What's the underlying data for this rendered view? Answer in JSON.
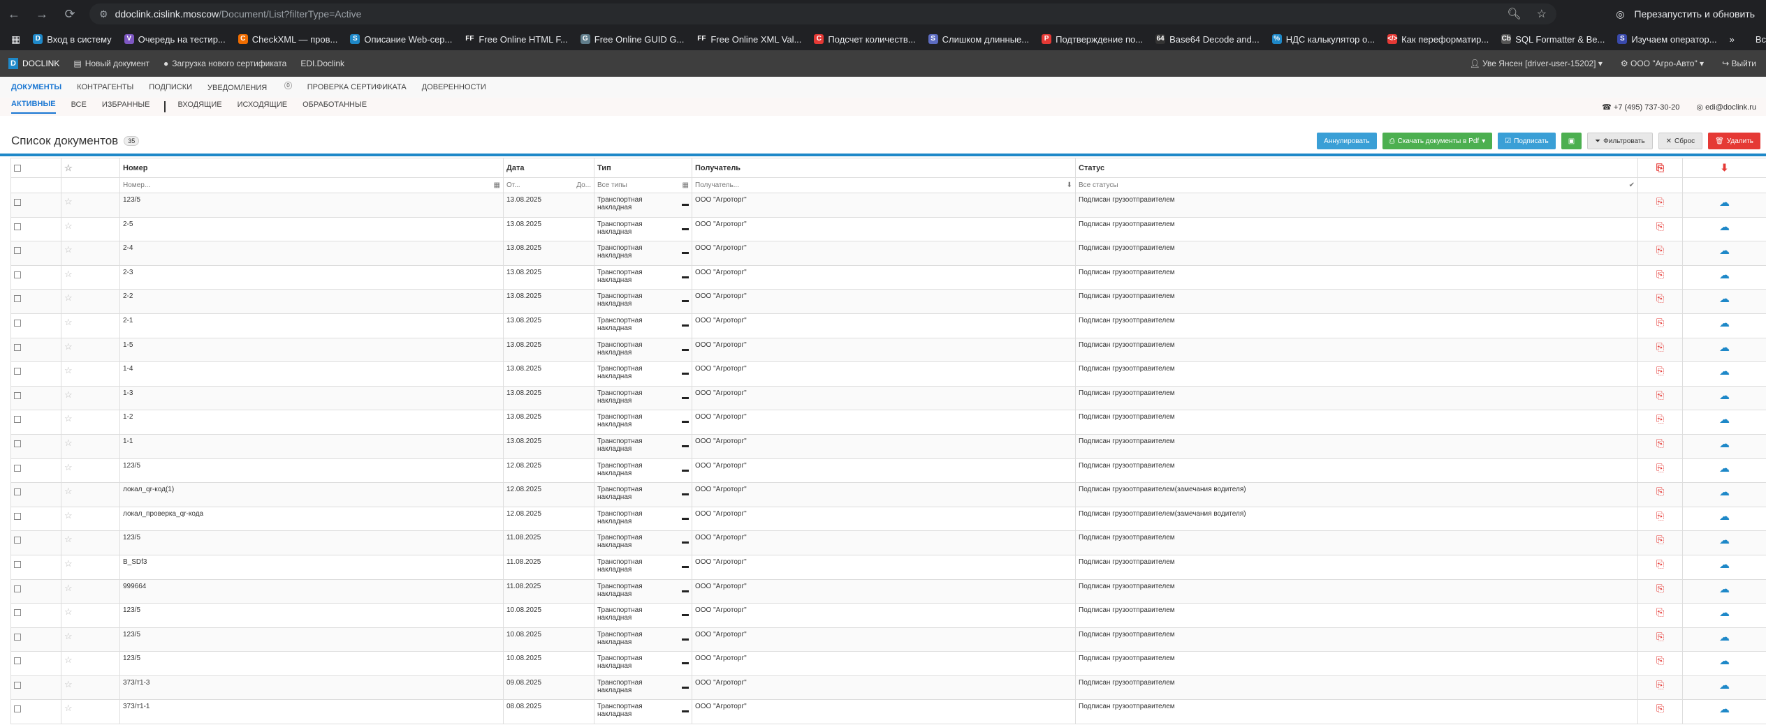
{
  "browser": {
    "url_host": "ddoclink.cislink.moscow",
    "url_path": "/Document/List?filterType=Active",
    "restart_label": "Перезапустить и обновить",
    "bookmarks": [
      {
        "label": "Вход в систему",
        "icon": "D",
        "color": "#1e88c8"
      },
      {
        "label": "Очередь на тестир...",
        "icon": "V",
        "color": "#7e57c2"
      },
      {
        "label": "CheckXML — пров...",
        "icon": "C",
        "color": "#ef6c00"
      },
      {
        "label": "Описание Web-сер...",
        "icon": "S",
        "color": "#1e88c8"
      },
      {
        "label": "Free Online HTML F...",
        "icon": "FF",
        "color": "#202124"
      },
      {
        "label": "Free Online GUID G...",
        "icon": "G",
        "color": "#607d8b"
      },
      {
        "label": "Free Online XML Val...",
        "icon": "FF",
        "color": "#202124"
      },
      {
        "label": "Подсчет количеств...",
        "icon": "C",
        "color": "#e53935"
      },
      {
        "label": "Слишком длинные...",
        "icon": "S",
        "color": "#5c6bc0"
      },
      {
        "label": "Подтверждение по...",
        "icon": "P",
        "color": "#e53935"
      },
      {
        "label": "Base64 Decode and...",
        "icon": "64",
        "color": "#333"
      },
      {
        "label": "НДС калькулятор о...",
        "icon": "%",
        "color": "#1e88c8"
      },
      {
        "label": "Как переформатир...",
        "icon": "</>",
        "color": "#e53935"
      },
      {
        "label": "SQL Formatter & Be...",
        "icon": "Cb",
        "color": "#555"
      },
      {
        "label": "Изучаем оператор...",
        "icon": "S",
        "color": "#3949ab"
      }
    ],
    "all_bookmarks": "Все заклад"
  },
  "appbar": {
    "logo": "DOCLINK",
    "new_doc": "Новый документ",
    "upload_cert": "Загрузка нового сертификата",
    "edi": "EDI.Doclink",
    "user": "Уве Янсен [driver-user-15202]",
    "org": "ООО \"Агро-Авто\"",
    "logout": "Выйти"
  },
  "topnav": [
    "ДОКУМЕНТЫ",
    "КОНТРАГЕНТЫ",
    "ПОДПИСКИ",
    "УВЕДОМЛЕНИЯ",
    "ПРОВЕРКА СЕРТИФИКАТА",
    "ДОВЕРЕННОСТИ"
  ],
  "notifications_count": "0",
  "subnav": [
    "АКТИВНЫЕ",
    "ВСЕ",
    "ИЗБРАННЫЕ",
    "ВХОДЯЩИЕ",
    "ИСХОДЯЩИЕ",
    "ОБРАБОТАННЫЕ"
  ],
  "phone": "+7 (495) 737-30-20",
  "email": "edi@doclink.ru",
  "page_title": "Список документов",
  "doc_count": "35",
  "toolbar": {
    "annul": "Аннулировать",
    "download_pdf": "Скачать документы в Pdf",
    "sign": "Подписать",
    "filter": "Фильтровать",
    "reset": "Сброс",
    "delete": "Удалить"
  },
  "columns": {
    "number": "Номер",
    "date": "Дата",
    "type": "Тип",
    "recipient": "Получатель",
    "status": "Статус"
  },
  "filters": {
    "number": "Номер...",
    "date_from": "От...",
    "date_to": "До...",
    "type": "Все типы",
    "recipient": "Получатель...",
    "status": "Все статусы"
  },
  "rows": [
    {
      "number": "123/5",
      "date": "13.08.2025",
      "type": "Транспортная накладная",
      "recipient": "ООО \"Агроторг\"",
      "status": "Подписан грузоотправителем"
    },
    {
      "number": "2-5",
      "date": "13.08.2025",
      "type": "Транспортная накладная",
      "recipient": "ООО \"Агроторг\"",
      "status": "Подписан грузоотправителем"
    },
    {
      "number": "2-4",
      "date": "13.08.2025",
      "type": "Транспортная накладная",
      "recipient": "ООО \"Агроторг\"",
      "status": "Подписан грузоотправителем"
    },
    {
      "number": "2-3",
      "date": "13.08.2025",
      "type": "Транспортная накладная",
      "recipient": "ООО \"Агроторг\"",
      "status": "Подписан грузоотправителем"
    },
    {
      "number": "2-2",
      "date": "13.08.2025",
      "type": "Транспортная накладная",
      "recipient": "ООО \"Агроторг\"",
      "status": "Подписан грузоотправителем"
    },
    {
      "number": "2-1",
      "date": "13.08.2025",
      "type": "Транспортная накладная",
      "recipient": "ООО \"Агроторг\"",
      "status": "Подписан грузоотправителем"
    },
    {
      "number": "1-5",
      "date": "13.08.2025",
      "type": "Транспортная накладная",
      "recipient": "ООО \"Агроторг\"",
      "status": "Подписан грузоотправителем"
    },
    {
      "number": "1-4",
      "date": "13.08.2025",
      "type": "Транспортная накладная",
      "recipient": "ООО \"Агроторг\"",
      "status": "Подписан грузоотправителем"
    },
    {
      "number": "1-3",
      "date": "13.08.2025",
      "type": "Транспортная накладная",
      "recipient": "ООО \"Агроторг\"",
      "status": "Подписан грузоотправителем"
    },
    {
      "number": "1-2",
      "date": "13.08.2025",
      "type": "Транспортная накладная",
      "recipient": "ООО \"Агроторг\"",
      "status": "Подписан грузоотправителем"
    },
    {
      "number": "1-1",
      "date": "13.08.2025",
      "type": "Транспортная накладная",
      "recipient": "ООО \"Агроторг\"",
      "status": "Подписан грузоотправителем"
    },
    {
      "number": "123/5",
      "date": "12.08.2025",
      "type": "Транспортная накладная",
      "recipient": "ООО \"Агроторг\"",
      "status": "Подписан грузоотправителем"
    },
    {
      "number": "локал_qr-код(1)",
      "date": "12.08.2025",
      "type": "Транспортная накладная",
      "recipient": "ООО \"Агроторг\"",
      "status": "Подписан грузоотправителем(замечания водителя)"
    },
    {
      "number": "локал_проверка_qr-кода",
      "date": "12.08.2025",
      "type": "Транспортная накладная",
      "recipient": "ООО \"Агроторг\"",
      "status": "Подписан грузоотправителем(замечания водителя)"
    },
    {
      "number": "123/5",
      "date": "11.08.2025",
      "type": "Транспортная накладная",
      "recipient": "ООО \"Агроторг\"",
      "status": "Подписан грузоотправителем"
    },
    {
      "number": "B_SDf3",
      "date": "11.08.2025",
      "type": "Транспортная накладная",
      "recipient": "ООО \"Агроторг\"",
      "status": "Подписан грузоотправителем"
    },
    {
      "number": "999664",
      "date": "11.08.2025",
      "type": "Транспортная накладная",
      "recipient": "ООО \"Агроторг\"",
      "status": "Подписан грузоотправителем"
    },
    {
      "number": "123/5",
      "date": "10.08.2025",
      "type": "Транспортная накладная",
      "recipient": "ООО \"Агроторг\"",
      "status": "Подписан грузоотправителем"
    },
    {
      "number": "123/5",
      "date": "10.08.2025",
      "type": "Транспортная накладная",
      "recipient": "ООО \"Агроторг\"",
      "status": "Подписан грузоотправителем"
    },
    {
      "number": "123/5",
      "date": "10.08.2025",
      "type": "Транспортная накладная",
      "recipient": "ООО \"Агроторг\"",
      "status": "Подписан грузоотправителем"
    },
    {
      "number": "373/т1-3",
      "date": "09.08.2025",
      "type": "Транспортная накладная",
      "recipient": "ООО \"Агроторг\"",
      "status": "Подписан грузоотправителем"
    },
    {
      "number": "373/т1-1",
      "date": "08.08.2025",
      "type": "Транспортная накладная",
      "recipient": "ООО \"Агроторг\"",
      "status": "Подписан грузоотправителем"
    }
  ]
}
